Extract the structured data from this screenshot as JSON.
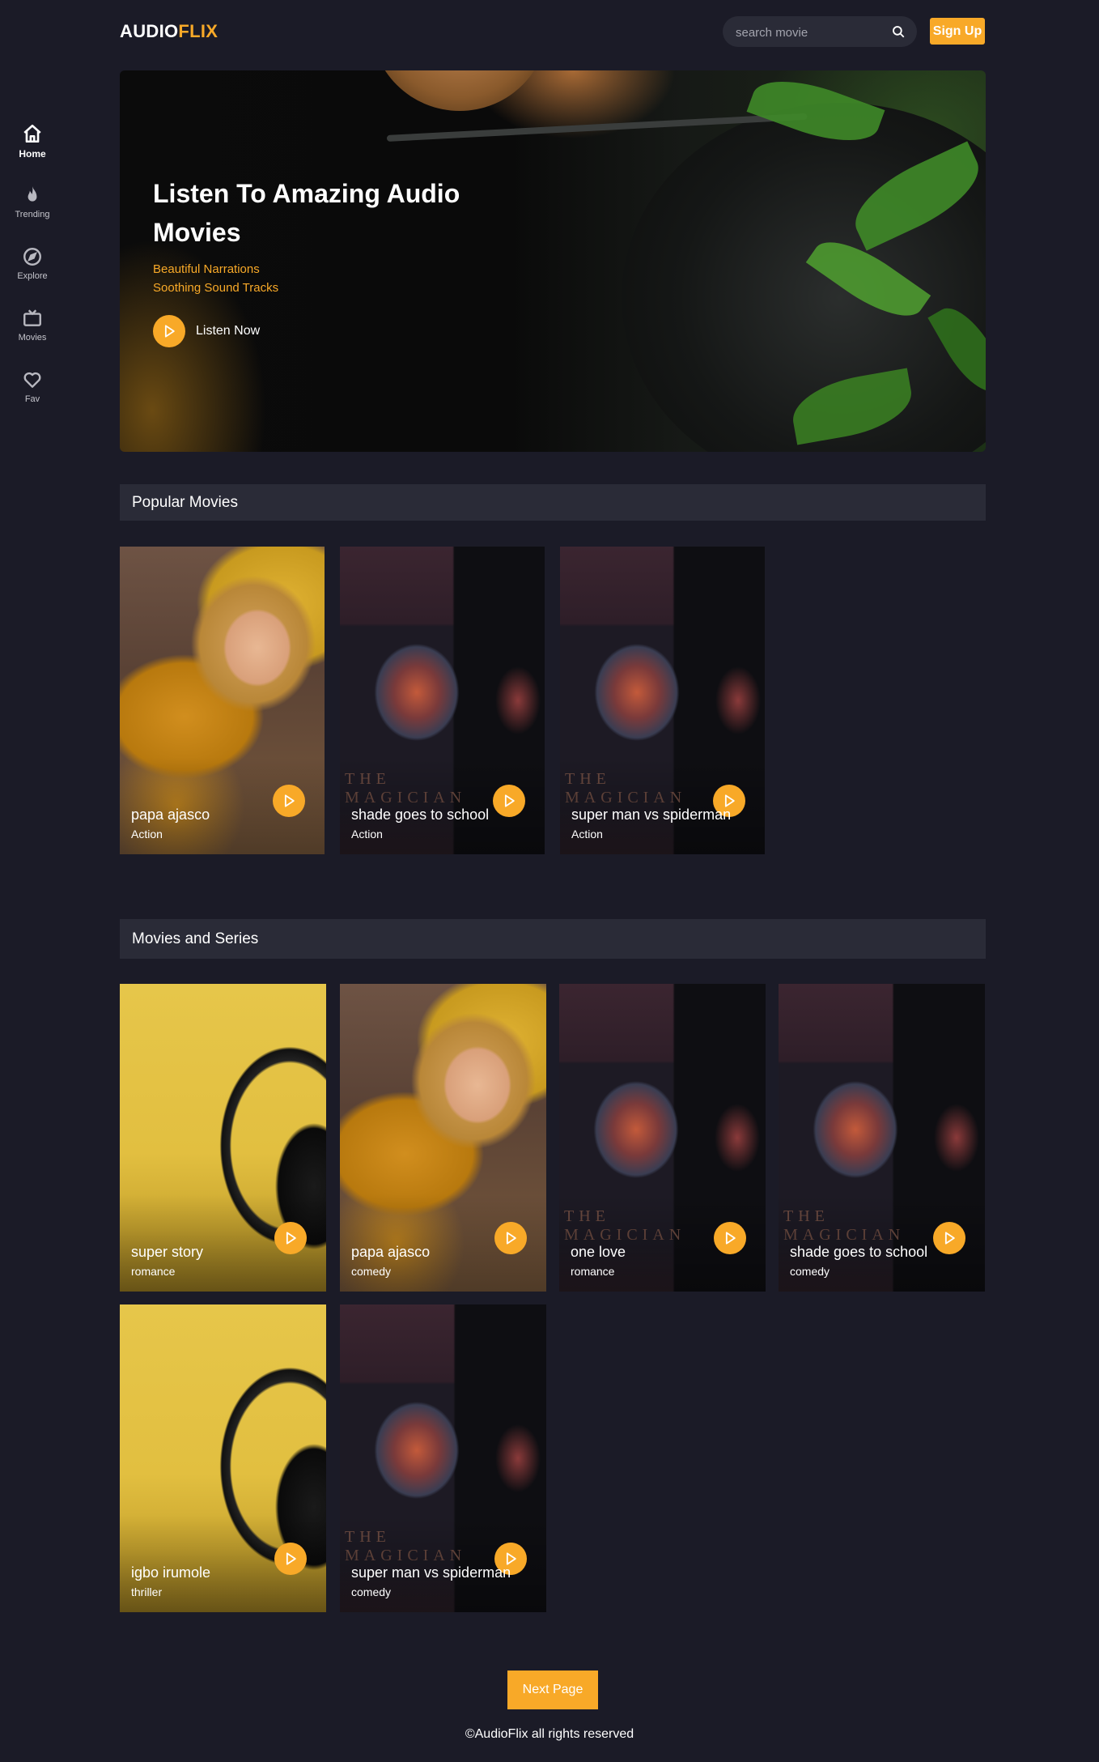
{
  "header": {
    "logo_part1": "AUDIO",
    "logo_part2": "FLIX",
    "search_placeholder": "search movie",
    "signup_label": "Sign Up"
  },
  "sidebar": {
    "items": [
      {
        "label": "Home",
        "icon": "home-icon",
        "active": true
      },
      {
        "label": "Trending",
        "icon": "flame-icon",
        "active": false
      },
      {
        "label": "Explore",
        "icon": "compass-icon",
        "active": false
      },
      {
        "label": "Movies",
        "icon": "tv-icon",
        "active": false
      },
      {
        "label": "Fav",
        "icon": "heart-icon",
        "active": false
      }
    ]
  },
  "hero": {
    "title": "Listen To Amazing Audio Movies",
    "sub1": "Beautiful Narrations",
    "sub2": "Soothing Sound Tracks",
    "cta": "Listen Now"
  },
  "popular": {
    "heading": "Popular Movies",
    "items": [
      {
        "title": "papa ajasco",
        "genre": "Action",
        "art": "girl"
      },
      {
        "title": "shade goes to school",
        "genre": "Action",
        "art": "magic"
      },
      {
        "title": "super man vs spiderman",
        "genre": "Action",
        "art": "magic"
      }
    ]
  },
  "series": {
    "heading": "Movies and Series",
    "items": [
      {
        "title": "super story",
        "genre": "romance",
        "art": "phones"
      },
      {
        "title": "papa ajasco",
        "genre": "comedy",
        "art": "girl"
      },
      {
        "title": "one love",
        "genre": "romance",
        "art": "magic"
      },
      {
        "title": "shade goes to school",
        "genre": "comedy",
        "art": "magic"
      },
      {
        "title": "igbo irumole",
        "genre": "thriller",
        "art": "phones"
      },
      {
        "title": "super man vs spiderman",
        "genre": "comedy",
        "art": "magic"
      }
    ]
  },
  "magic_cover_text": "THE MAGICIAN",
  "next_label": "Next Page",
  "footer": "©AudioFlix all rights reserved",
  "colors": {
    "accent": "#f8a928",
    "background": "#1b1b27",
    "panel": "#2a2b37"
  }
}
